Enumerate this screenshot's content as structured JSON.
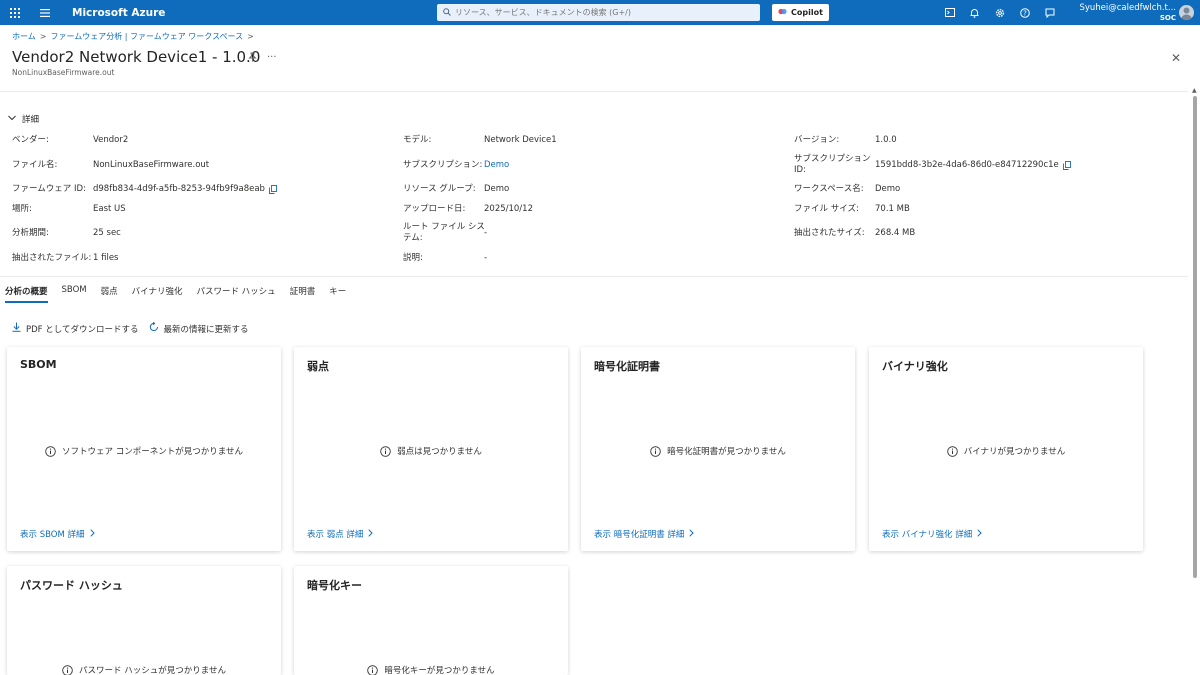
{
  "topbar": {
    "brand": "Microsoft Azure",
    "search_placeholder": "リソース、サービス、ドキュメントの検索 (G+/)",
    "copilot_label": "Copilot",
    "user": "Syuhei@caledfwlch.t...",
    "org": "SOC",
    "color": "#0f6cbd"
  },
  "breadcrumb": {
    "home": "ホーム",
    "item1": "ファームウェア分析 | ファームウェア ワークスペース"
  },
  "header": {
    "title": "Vendor2 Network Device1 - 1.0.0",
    "subtitle": "NonLinuxBaseFirmware.out"
  },
  "details": {
    "toggle_label": "詳細",
    "col1": [
      {
        "label": "ベンダー:",
        "value": "Vendor2"
      },
      {
        "label": "ファイル名:",
        "value": "NonLinuxBaseFirmware.out"
      },
      {
        "label": "ファームウェア ID:",
        "value": "d98fb834-4d9f-a5fb-8253-94fb9f9a8eab"
      },
      {
        "label": "場所:",
        "value": "East US"
      },
      {
        "label": "分析期間:",
        "value": "25 sec"
      },
      {
        "label": "抽出されたファイル:",
        "value": "1 files"
      }
    ],
    "col2": [
      {
        "label": "モデル:",
        "value": "Network Device1"
      },
      {
        "label": "サブスクリプション:",
        "value": "Demo"
      },
      {
        "label": "リソース グループ:",
        "value": "Demo"
      },
      {
        "label": "アップロード日:",
        "value": "2025/10/12"
      },
      {
        "label": "ルート ファイル システム:",
        "value": "-"
      },
      {
        "label": "説明:",
        "value": "-"
      }
    ],
    "col3": [
      {
        "label": "バージョン:",
        "value": "1.0.0"
      },
      {
        "label": "サブスクリプション ID:",
        "value": "1591bdd8-3b2e-4da6-86d0-e84712290c1e"
      },
      {
        "label": "ワークスペース名:",
        "value": "Demo"
      },
      {
        "label": "ファイル サイズ:",
        "value": "70.1 MB"
      },
      {
        "label": "抽出されたサイズ:",
        "value": "268.4 MB"
      }
    ]
  },
  "tabs": [
    "分析の概要",
    "SBOM",
    "弱点",
    "バイナリ強化",
    "パスワード ハッシュ",
    "証明書",
    "キー"
  ],
  "actions": {
    "download": "PDF としてダウンロードする",
    "refresh": "最新の情報に更新する"
  },
  "cards": [
    {
      "title": "SBOM",
      "empty": "ソフトウェア コンポーネントが見つかりません",
      "link": "表示 SBOM 詳細"
    },
    {
      "title": "弱点",
      "empty": "弱点は見つかりません",
      "link": "表示 弱点 詳細"
    },
    {
      "title": "暗号化証明書",
      "empty": "暗号化証明書が見つかりません",
      "link": "表示 暗号化証明書 詳細"
    },
    {
      "title": "バイナリ強化",
      "empty": "バイナリが見つかりません",
      "link": "表示 バイナリ強化 詳細"
    },
    {
      "title": "パスワード ハッシュ",
      "empty": "パスワード ハッシュが見つかりません"
    },
    {
      "title": "暗号化キー",
      "empty": "暗号化キーが見つかりません"
    }
  ]
}
